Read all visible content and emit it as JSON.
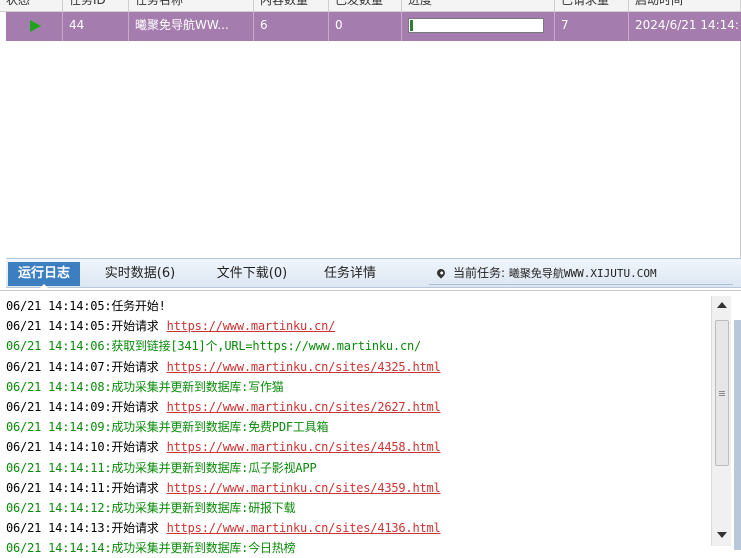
{
  "table": {
    "columns": [
      "状态",
      "任务ID",
      "任务名称",
      "内容数量",
      "已发数量",
      "进度",
      "已请求量",
      "启动时间"
    ],
    "row": {
      "status_icon": "play-icon",
      "task_id": "44",
      "task_name": "曦聚免导航WW...",
      "content_count": "6",
      "sent_count": "0",
      "progress": 0.02,
      "requested": "7",
      "start_time": "2024/6/21 14:14:"
    }
  },
  "tabs": [
    {
      "label": "运行日志",
      "active": true
    },
    {
      "label": "实时数据(6)",
      "active": false
    },
    {
      "label": "文件下载(0)",
      "active": false
    },
    {
      "label": "任务详情",
      "active": false
    }
  ],
  "current_task": {
    "icon": "location-pin-icon",
    "label": "当前任务:",
    "value": "曦聚免导航WWW.XIJUTU.COM"
  },
  "log": [
    {
      "time": "06/21 14:14:05:",
      "text": "任务开始!",
      "link": "",
      "color": "black"
    },
    {
      "time": "06/21 14:14:05:",
      "text": "开始请求",
      "link": "https://www.martinku.cn/",
      "color": "black"
    },
    {
      "time": "06/21 14:14:06:",
      "text": "获取到链接[341]个,URL=https://www.martinku.cn/",
      "link": "",
      "color": "green"
    },
    {
      "time": "06/21 14:14:07:",
      "text": "开始请求",
      "link": "https://www.martinku.cn/sites/4325.html",
      "color": "black"
    },
    {
      "time": "06/21 14:14:08:",
      "text": "成功采集并更新到数据库:写作猫",
      "link": "",
      "color": "green"
    },
    {
      "time": "06/21 14:14:09:",
      "text": "开始请求",
      "link": "https://www.martinku.cn/sites/2627.html",
      "color": "black"
    },
    {
      "time": "06/21 14:14:09:",
      "text": "成功采集并更新到数据库:免费PDF工具箱",
      "link": "",
      "color": "green"
    },
    {
      "time": "06/21 14:14:10:",
      "text": "开始请求",
      "link": "https://www.martinku.cn/sites/4458.html",
      "color": "black"
    },
    {
      "time": "06/21 14:14:11:",
      "text": "成功采集并更新到数据库:瓜子影视APP",
      "link": "",
      "color": "green"
    },
    {
      "time": "06/21 14:14:11:",
      "text": "开始请求",
      "link": "https://www.martinku.cn/sites/4359.html",
      "color": "black"
    },
    {
      "time": "06/21 14:14:12:",
      "text": "成功采集并更新到数据库:研报下载",
      "link": "",
      "color": "green"
    },
    {
      "time": "06/21 14:14:13:",
      "text": "开始请求",
      "link": "https://www.martinku.cn/sites/4136.html",
      "color": "black"
    },
    {
      "time": "06/21 14:14:14:",
      "text": "成功采集并更新到数据库:今日热榜",
      "link": "",
      "color": "green"
    }
  ],
  "colors": {
    "selected_row": "#a47cad",
    "active_tab": "#3c7fc0",
    "log_green": "#0a8a0a",
    "log_link": "#cc3333"
  }
}
